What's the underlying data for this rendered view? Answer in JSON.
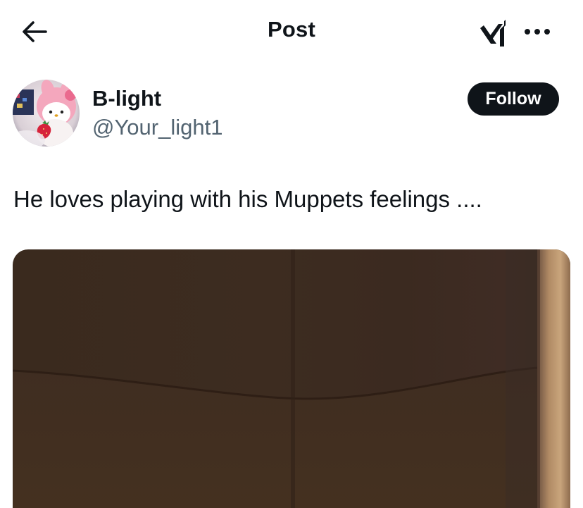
{
  "header": {
    "back_icon": "arrow-left-icon",
    "title": "Post",
    "grok_icon": "grok-icon",
    "more_icon": "more-horizontal-icon"
  },
  "author": {
    "display_name": "B-light",
    "handle": "@Your_light1",
    "follow_label": "Follow"
  },
  "tweet": {
    "text": "He loves playing with his Muppets feelings ...."
  },
  "media": {
    "kind": "image",
    "dominant_color": "#3b2a1f"
  },
  "colors": {
    "text_primary": "#0f1419",
    "text_secondary": "#536471",
    "button_dark": "#0f1419",
    "background": "#ffffff"
  }
}
